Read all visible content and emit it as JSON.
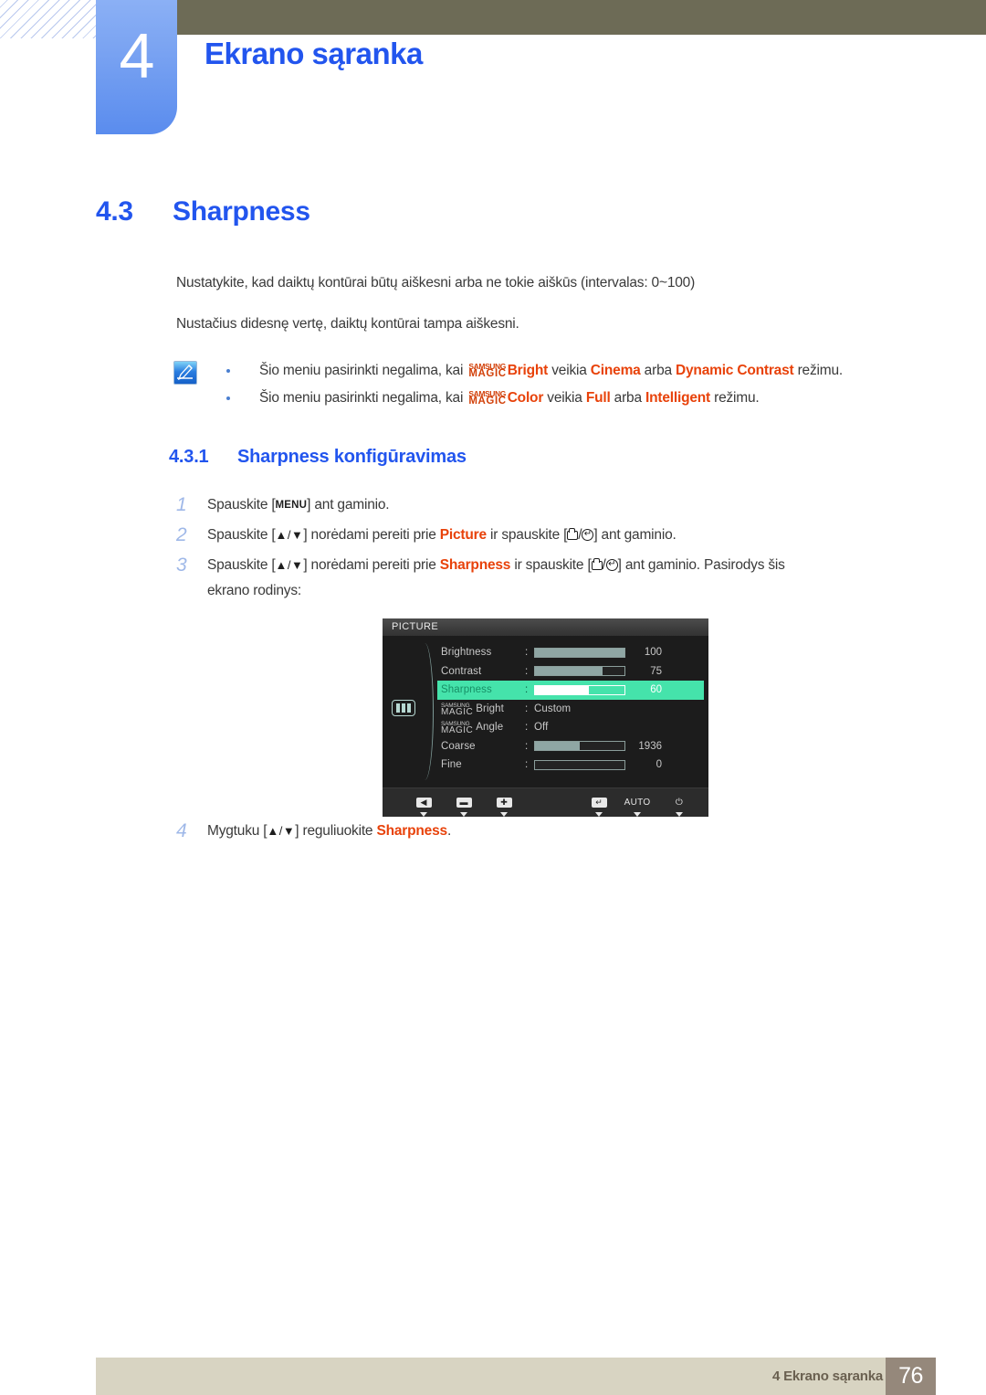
{
  "header": {
    "chapter_number": "4",
    "chapter_title": "Ekrano sąranka",
    "accent_blue": "#2255ee",
    "olive": "#6d6b56"
  },
  "section": {
    "number": "4.3",
    "title": "Sharpness",
    "paragraph_1": "Nustatykite, kad daiktų kontūrai būtų aiškesni arba ne tokie aiškūs (intervalas: 0~100)",
    "paragraph_2": "Nustačius didesnę vertę, daiktų kontūrai tampa aiškesni."
  },
  "note": {
    "icon": "note-pen-icon",
    "items": [
      {
        "prefix": "Šio meniu pasirinkti negalima, kai ",
        "magic_top": "SAMSUNG",
        "magic_bottom": "MAGIC",
        "magic_suffix": "Bright",
        "mid": " veikia ",
        "option_1": "Cinema",
        "conj": " arba ",
        "option_2": "Dynamic Contrast",
        "tail": " režimu."
      },
      {
        "prefix": "Šio meniu pasirinkti negalima, kai ",
        "magic_top": "SAMSUNG",
        "magic_bottom": "MAGIC",
        "magic_suffix": "Color",
        "mid": " veikia ",
        "option_1": "Full",
        "conj": " arba ",
        "option_2": "Intelligent",
        "tail": " režimu."
      }
    ]
  },
  "subsection": {
    "number": "4.3.1",
    "title": "Sharpness konfigūravimas"
  },
  "steps": [
    {
      "index": "1",
      "pre": "Spauskite [",
      "key": "MENU",
      "post": "] ant gaminio."
    },
    {
      "index": "2",
      "pre": "Spauskite [",
      "keys": "▲/▼",
      "mid": "] norėdami pereiti prie ",
      "target": "Picture",
      "mid2": " ir spauskite [",
      "keys2": "/",
      "post": "] ant gaminio."
    },
    {
      "index": "3",
      "pre": "Spauskite [",
      "keys": "▲/▼",
      "mid": "] norėdami pereiti prie ",
      "target": "Sharpness",
      "mid2": " ir spauskite [",
      "post": "] ant gaminio. Pasirodys šis",
      "line2": "ekrano rodinys:"
    },
    {
      "index": "4",
      "pre": "Mygtuku [",
      "keys": "▲/▼",
      "mid": "] reguliuokite ",
      "target": "Sharpness",
      "post": "."
    }
  ],
  "osd": {
    "title": "PICTURE",
    "category_icon": "picture-bars-icon",
    "highlight_color": "#45e3ab",
    "rows": [
      {
        "label": "Brightness",
        "type": "bar",
        "fill_pct": 100,
        "value": "100",
        "highlighted": false
      },
      {
        "label": "Contrast",
        "type": "bar",
        "fill_pct": 75,
        "value": "75",
        "highlighted": false
      },
      {
        "label": "Sharpness",
        "type": "bar",
        "fill_pct": 60,
        "value": "60",
        "highlighted": true
      },
      {
        "label": "Bright",
        "magic_top": "SAMSUNG",
        "magic_bottom": "MAGIC",
        "type": "text",
        "value": "Custom",
        "highlighted": false
      },
      {
        "label": "Angle",
        "magic_top": "SAMSUNG",
        "magic_bottom": "MAGIC",
        "type": "text",
        "value": "Off",
        "highlighted": false
      },
      {
        "label": "Coarse",
        "type": "bar",
        "fill_pct": 50,
        "value": "1936",
        "highlighted": false
      },
      {
        "label": "Fine",
        "type": "bar",
        "fill_pct": 0,
        "value": "0",
        "highlighted": false
      }
    ],
    "footer_buttons": [
      {
        "name": "left-arrow-button",
        "glyph": "◀",
        "style": "boxed"
      },
      {
        "name": "minus-button",
        "glyph": "▬",
        "style": "boxed"
      },
      {
        "name": "plus-button",
        "glyph": "✚",
        "style": "boxed"
      },
      {
        "name": "enter-button",
        "glyph": "↵",
        "style": "boxed"
      },
      {
        "name": "auto-button",
        "glyph": "AUTO",
        "style": "plain"
      },
      {
        "name": "power-button",
        "glyph": "⏻",
        "style": "plain"
      }
    ]
  },
  "footer": {
    "text": "4 Ekrano sąranka",
    "page_number": "76",
    "bar_color": "#d8d4c2",
    "page_box_color": "#95887b"
  }
}
